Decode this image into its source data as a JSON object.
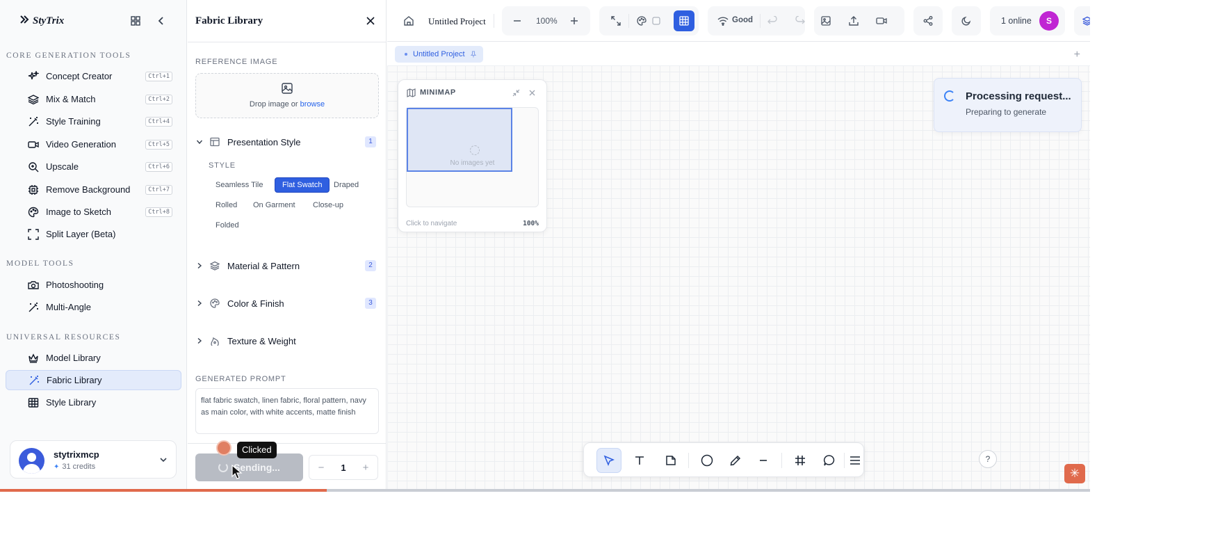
{
  "app": {
    "name": "StyTrix"
  },
  "sidebar": {
    "sections": [
      {
        "title": "CORE GENERATION TOOLS"
      },
      {
        "title": "MODEL TOOLS"
      },
      {
        "title": "UNIVERSAL RESOURCES"
      }
    ],
    "items": [
      {
        "label": "Concept Creator",
        "shortcut": "Ctrl+1",
        "icon": "sparkles-icon"
      },
      {
        "label": "Mix & Match",
        "shortcut": "Ctrl+2",
        "icon": "layers-icon"
      },
      {
        "label": "Style Training",
        "shortcut": "Ctrl+4",
        "icon": "magic-wand-icon"
      },
      {
        "label": "Video Generation",
        "shortcut": "Ctrl+5",
        "icon": "video-icon"
      },
      {
        "label": "Upscale",
        "shortcut": "Ctrl+6",
        "icon": "zoom-in-icon"
      },
      {
        "label": "Remove Background",
        "shortcut": "Ctrl+7",
        "icon": "cpu-icon"
      },
      {
        "label": "Image to Sketch",
        "shortcut": "Ctrl+8",
        "icon": "palette-icon"
      },
      {
        "label": "Split Layer (Beta)",
        "shortcut": "",
        "icon": "frame-icon"
      },
      {
        "label": "Photoshooting",
        "shortcut": "",
        "icon": "camera-icon"
      },
      {
        "label": "Multi-Angle",
        "shortcut": "",
        "icon": "magic-wand-icon"
      },
      {
        "label": "Model Library",
        "shortcut": "",
        "icon": "crown-icon"
      },
      {
        "label": "Fabric Library",
        "shortcut": "",
        "icon": "magic-wand-icon",
        "active": true
      },
      {
        "label": "Style Library",
        "shortcut": "",
        "icon": "table-icon"
      }
    ],
    "user": {
      "name": "stytrixmcp",
      "credits": "31 credits"
    }
  },
  "panel": {
    "title": "Fabric Library",
    "reference_label": "REFERENCE IMAGE",
    "drop_text": "Drop image or",
    "drop_link": "browse",
    "sections": [
      {
        "label": "Presentation Style",
        "badge": "1",
        "expanded": true
      },
      {
        "label": "Material & Pattern",
        "badge": "2",
        "expanded": false
      },
      {
        "label": "Color & Finish",
        "badge": "3",
        "expanded": false
      },
      {
        "label": "Texture & Weight",
        "badge": "",
        "expanded": false
      }
    ],
    "style_label": "STYLE",
    "chips": [
      "Seamless Tile",
      "Flat Swatch",
      "Draped",
      "Rolled",
      "On Garment",
      "Close-up",
      "Folded"
    ],
    "selected_chip": "Flat Swatch",
    "prompt_label": "GENERATED PROMPT",
    "prompt": "flat fabric swatch, linen fabric, floral pattern, navy as main color, with white accents, matte finish",
    "generate_label": "Sending...",
    "quantity": "1",
    "click_tooltip": "Clicked"
  },
  "toolbar": {
    "project_name": "Untitled Project",
    "zoom": "100%",
    "connection": "Good",
    "online": "1 online",
    "online_avatar": "S"
  },
  "canvas": {
    "tab": "Untitled Project",
    "minimap": {
      "title": "MINIMAP",
      "empty": "No images yet",
      "footer": "Click to navigate",
      "zoom": "100%"
    },
    "toast": {
      "title": "Processing request...",
      "subtitle": "Preparing to generate"
    },
    "tools": [
      "select-tool",
      "text-tool",
      "sticky-note-tool",
      "circle-tool",
      "pen-tool",
      "line-tool",
      "frame-tool",
      "comment-tool",
      "menu"
    ],
    "progress": 0.3
  },
  "colors": {
    "accent": "#2f5fe0",
    "progress": "#e06a4c",
    "avatar": "#c026d3"
  }
}
